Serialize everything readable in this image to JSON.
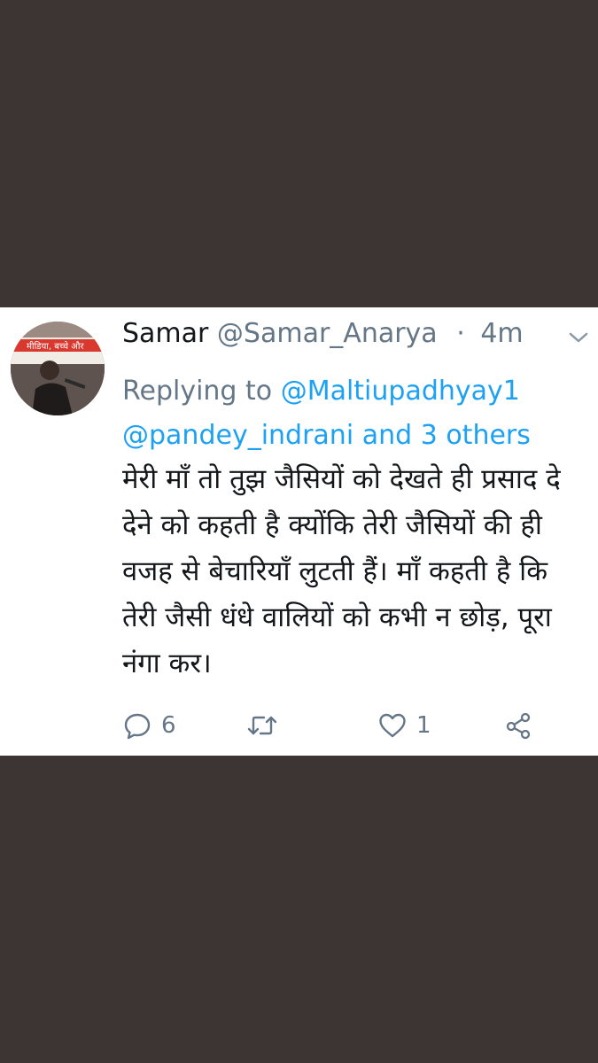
{
  "tweet": {
    "author_name": "Samar",
    "author_handle": "@Samar_Anarya",
    "separator": "·",
    "time": "4m",
    "replying_to_prefix": "Replying to",
    "replying_to_user": "@Maltiupadhyay1",
    "replying_to_second": "@pandey_indrani",
    "replying_to_and": "and",
    "replying_to_others": "3 others",
    "text": "मेरी माँ तो तुझ जैसियों को देखते ही प्रसाद दे देने को कहती है क्योंकि तेरी जैसियों की ही वजह से बेचारियाँ लुटती हैं। माँ कहती है कि तेरी जैसी धंधे वालियों को कभी न छोड़, पूरा नंगा कर।",
    "avatar_banner_text": "मीडिया, बच्चे और"
  },
  "actions": {
    "reply_icon": "reply-icon",
    "reply_count": "6",
    "retweet_icon": "retweet-icon",
    "like_icon": "heart-icon",
    "like_count": "1",
    "share_icon": "share-icon"
  },
  "colors": {
    "background": "#3d3533",
    "card": "#ffffff",
    "text": "#14171a",
    "secondary": "#657786",
    "link": "#1da1f2"
  }
}
